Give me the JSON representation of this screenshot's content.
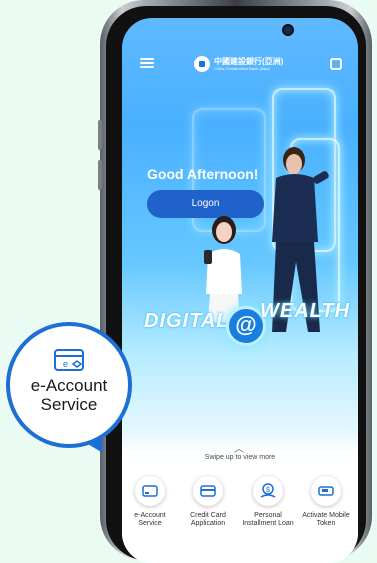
{
  "app": {
    "bank_name": "中國建設銀行(亞洲)",
    "bank_name_en": "China Construction Bank (Asia)"
  },
  "hero": {
    "greeting": "Good Afternoon!",
    "logon_label": "Logon",
    "campaign_left": "DIGITAL",
    "campaign_symbol": "@",
    "campaign_right": "WEALTH"
  },
  "bottom_sheet": {
    "swipe_hint": "Swipe up to view more",
    "shortcuts": [
      {
        "label": "e-Account Service",
        "icon": "card-id-icon"
      },
      {
        "label": "Credit Card Application",
        "icon": "credit-card-icon"
      },
      {
        "label": "Personal Installment Loan",
        "icon": "money-hand-icon"
      },
      {
        "label": "Activate Mobile Token",
        "icon": "token-device-icon"
      }
    ]
  },
  "callout": {
    "label": "e-Account Service",
    "icon": "card-id-icon"
  },
  "colors": {
    "accent": "#1d6fd6",
    "button": "#1f62c9",
    "background": "#e9fbf2"
  }
}
